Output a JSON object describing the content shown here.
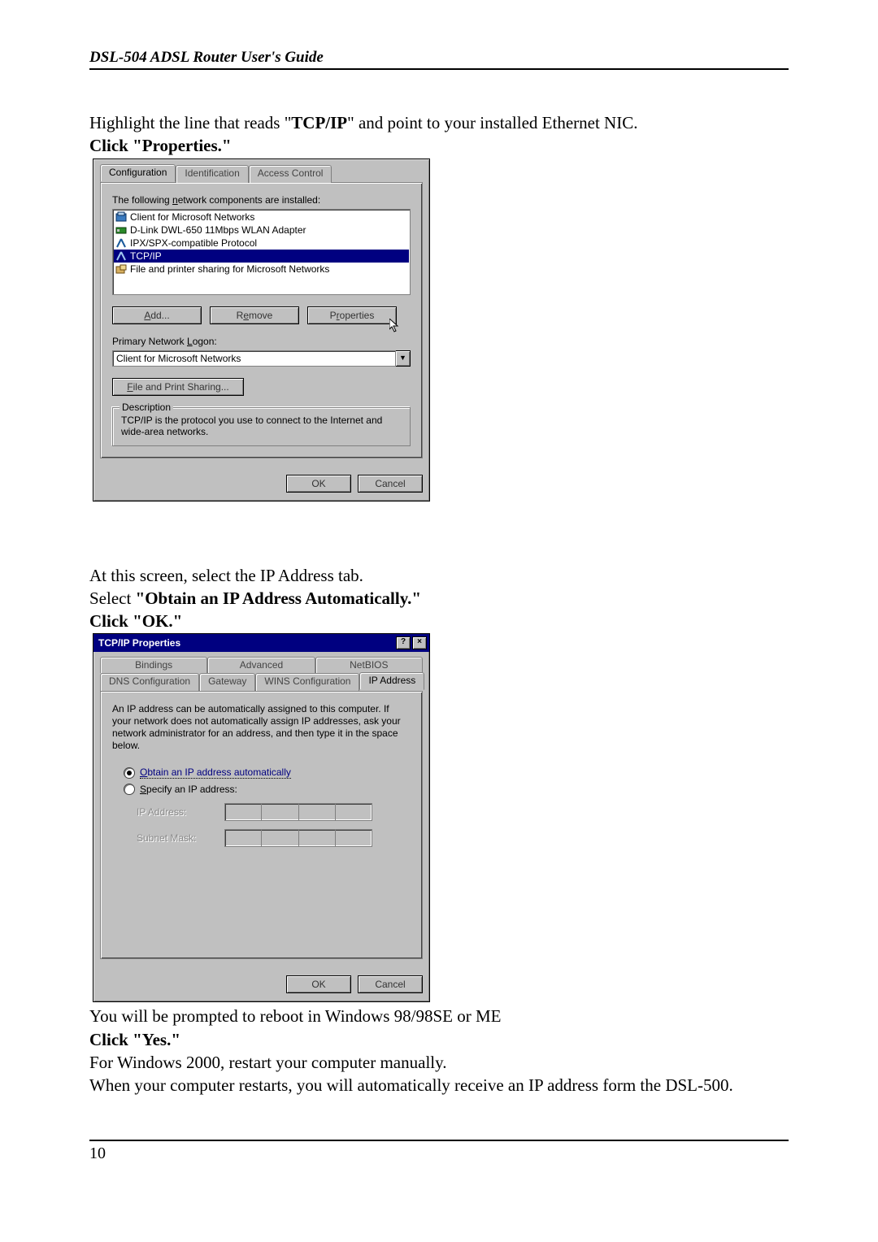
{
  "header": {
    "title": "DSL-504 ADSL Router User's Guide"
  },
  "intro1_a": "Highlight the line that reads \"",
  "intro1_b": "TCP/IP",
  "intro1_c": "\" and point to your installed Ethernet NIC.",
  "intro2": "Click \"Properties.\"",
  "dlg1": {
    "tabs": [
      "Configuration",
      "Identification",
      "Access Control"
    ],
    "label_installed": "The following network components are installed:",
    "items": [
      {
        "icon": "client",
        "label": "Client for Microsoft Networks"
      },
      {
        "icon": "nic",
        "label": "D-Link DWL-650 11Mbps WLAN Adapter"
      },
      {
        "icon": "proto",
        "label": "IPX/SPX-compatible Protocol"
      },
      {
        "icon": "proto",
        "label": "TCP/IP",
        "selected": true
      },
      {
        "icon": "service",
        "label": "File and printer sharing for Microsoft Networks"
      }
    ],
    "btn_add": "Add...",
    "btn_remove": "Remove",
    "btn_props": "Properties",
    "label_logon": "Primary Network Logon:",
    "logon_value": "Client for Microsoft Networks",
    "btn_fps": "File and Print Sharing...",
    "desc_legend": "Description",
    "desc_text": "TCP/IP is the protocol you use to connect to the Internet and wide-area networks.",
    "ok": "OK",
    "cancel": "Cancel"
  },
  "mid1": "At this screen, select the IP Address tab.",
  "mid2": "Select \"Obtain an IP Address Automatically.\"",
  "mid3": "Click \"OK.\"",
  "dlg2": {
    "title": "TCP/IP Properties",
    "tabs_row1": [
      "Bindings",
      "Advanced",
      "NetBIOS"
    ],
    "tabs_row2": [
      "DNS Configuration",
      "Gateway",
      "WINS Configuration",
      "IP Address"
    ],
    "desc": "An IP address can be automatically assigned to this computer. If your network does not automatically assign IP addresses, ask your network administrator for an address, and then type it in the space below.",
    "radio_auto": "Obtain an IP address automatically",
    "radio_spec": "Specify an IP address:",
    "ip_label": "IP Address:",
    "mask_label": "Subnet Mask:",
    "ok": "OK",
    "cancel": "Cancel"
  },
  "out1": "You will be prompted to reboot in Windows 98/98SE or ME",
  "out2": "Click \"Yes.\"",
  "out3": "For Windows 2000, restart your computer manually.",
  "out4": "When your computer restarts, you will automatically receive an IP address form the DSL-500.",
  "page_number": "10"
}
